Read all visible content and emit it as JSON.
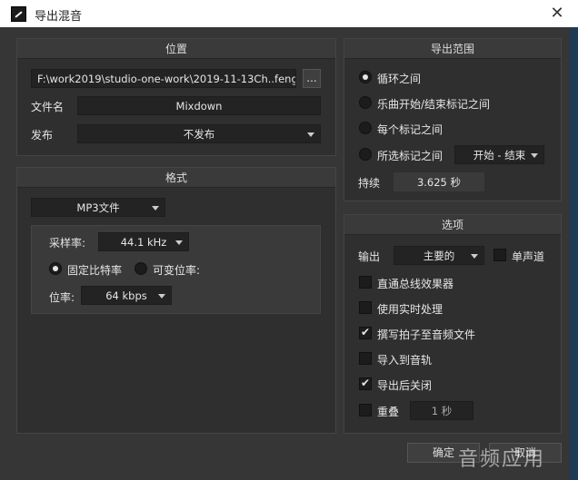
{
  "window": {
    "title": "导出混音",
    "close_glyph": "✕"
  },
  "location": {
    "header": "位置",
    "path": "F:\\work2019\\studio-one-work\\2019-11-13Ch..feng",
    "browse_label": "...",
    "filename_label": "文件名",
    "filename_value": "Mixdown",
    "publish_label": "发布",
    "publish_value": "不发布"
  },
  "format": {
    "header": "格式",
    "format_value": "MP3文件",
    "samplerate_label": "采样率:",
    "samplerate_value": "44.1 kHz",
    "cbr_label": "固定比特率",
    "vbr_label": "可变位率:",
    "cbr_selected": true,
    "bitrate_label": "位率:",
    "bitrate_value": "64 kbps"
  },
  "range": {
    "header": "导出范围",
    "options": [
      {
        "label": "循环之间",
        "selected": true
      },
      {
        "label": "乐曲开始/结束标记之间",
        "selected": false
      },
      {
        "label": "每个标记之间",
        "selected": false
      },
      {
        "label": "所选标记之间",
        "selected": false
      }
    ],
    "marker_select": "开始 - 结束",
    "duration_label": "持续",
    "duration_value": "3.625 秒"
  },
  "options": {
    "header": "选项",
    "output_label": "输出",
    "output_value": "主要的",
    "mono_label": "单声道",
    "mono_checked": false,
    "items": [
      {
        "label": "直通总线效果器",
        "checked": false
      },
      {
        "label": "使用实时处理",
        "checked": false
      },
      {
        "label": "撰写拍子至音频文件",
        "checked": true
      },
      {
        "label": "导入到音轨",
        "checked": false
      },
      {
        "label": "导出后关闭",
        "checked": true
      }
    ],
    "overlap_label": "重叠",
    "overlap_checked": false,
    "overlap_value": "1 秒"
  },
  "footer": {
    "ok_label": "确定",
    "cancel_label": "取消"
  },
  "watermark": "音频应用"
}
